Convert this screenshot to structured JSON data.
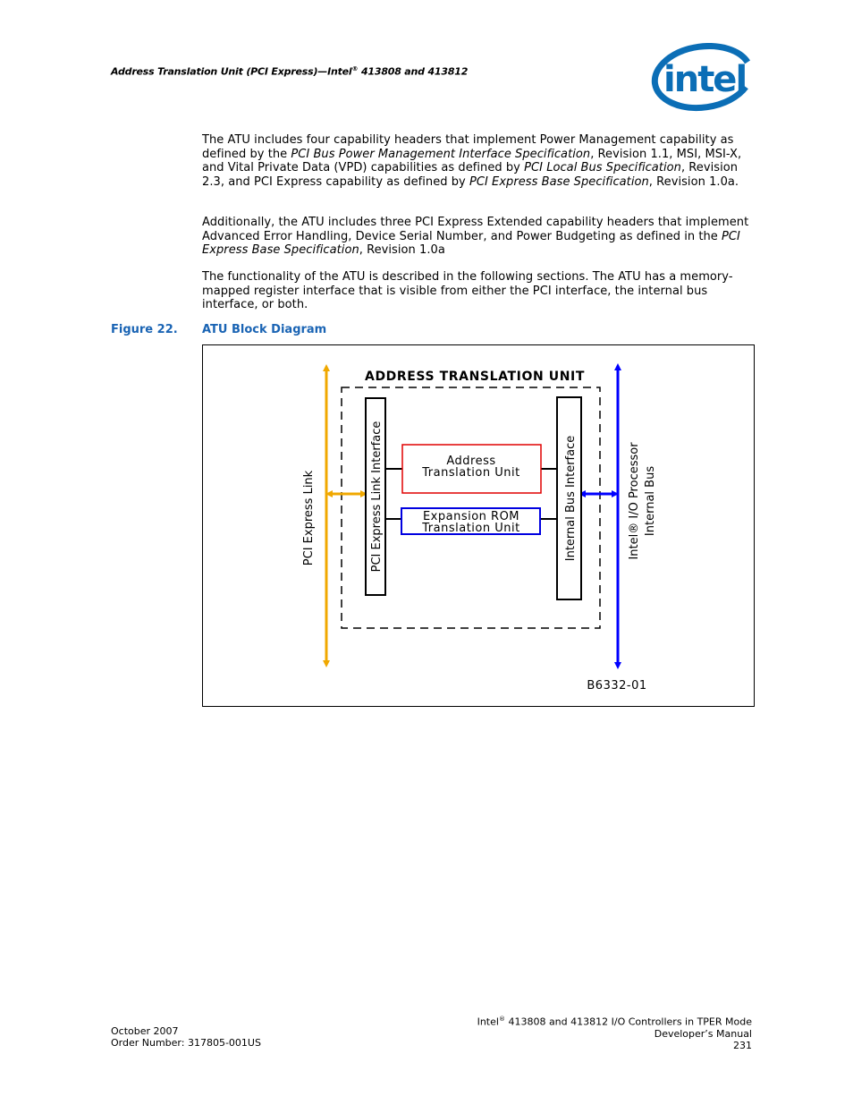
{
  "header": {
    "running_title_prefix": "Address Translation Unit (PCI Express)—Intel",
    "running_title_reg": "®",
    "running_title_suffix": " 413808 and 413812",
    "logo": {
      "icon": "intel-logo-icon",
      "text": "intel",
      "color": "#0b6eb6"
    }
  },
  "body": {
    "paragraphs": [
      {
        "segments": [
          {
            "text": "The ATU includes four capability headers that implement Power Management capability as defined by the ",
            "italic": false
          },
          {
            "text": "PCI Bus Power Management Interface Specification",
            "italic": true
          },
          {
            "text": ", Revision 1.1, MSI, MSI-X, and Vital Private Data (VPD) capabilities as defined by ",
            "italic": false
          },
          {
            "text": "PCI Local Bus Specification",
            "italic": true
          },
          {
            "text": ", Revision 2.3, and PCI Express capability as defined by ",
            "italic": false
          },
          {
            "text": "PCI Express Base Specification",
            "italic": true
          },
          {
            "text": ", Revision 1.0a.",
            "italic": false
          }
        ]
      },
      {
        "segments": [
          {
            "text": "Additionally, the ATU includes three PCI Express Extended capability headers that implement Advanced Error Handling, Device Serial Number, and Power Budgeting as defined in the ",
            "italic": false
          },
          {
            "text": "PCI Express Base Specification",
            "italic": true
          },
          {
            "text": ", Revision 1.0a",
            "italic": false
          }
        ]
      },
      {
        "segments": [
          {
            "text": "The functionality of the ATU is described in the following sections. The ATU has a memory-mapped register interface that is visible from either the PCI interface, the internal bus interface, or both.",
            "italic": false
          }
        ]
      }
    ]
  },
  "figure": {
    "number": "Figure 22.",
    "title": "ATU Block Diagram",
    "caption_color": "#1a64b4",
    "diagram": {
      "title": "ADDRESS TRANSLATION UNIT",
      "left_bus_label": "PCI Express Link",
      "left_bus_color": "#f0a800",
      "right_bus_label_line1": "Intel® I/O Processor",
      "right_bus_label_line2": "Internal Bus",
      "right_bus_color": "#0000ff",
      "left_interface_label": "PCI Express Link Interface",
      "right_interface_label": "Internal Bus Interface",
      "atu_block_line1": "Address",
      "atu_block_line2": "Translation Unit",
      "atu_block_color": "#e00000",
      "rom_block_line1": "Expansion ROM",
      "rom_block_line2": "Translation Unit",
      "rom_block_color": "#0000e0",
      "figure_id": "B6332-01"
    }
  },
  "footer": {
    "date": "October 2007",
    "order_number": "Order Number: 317805-001US",
    "doc_title_prefix": "Intel",
    "doc_title_reg": "®",
    "doc_title_suffix": " 413808 and 413812 I/O Controllers in TPER Mode",
    "doc_subtitle": "Developer’s Manual",
    "page_number": "231"
  }
}
